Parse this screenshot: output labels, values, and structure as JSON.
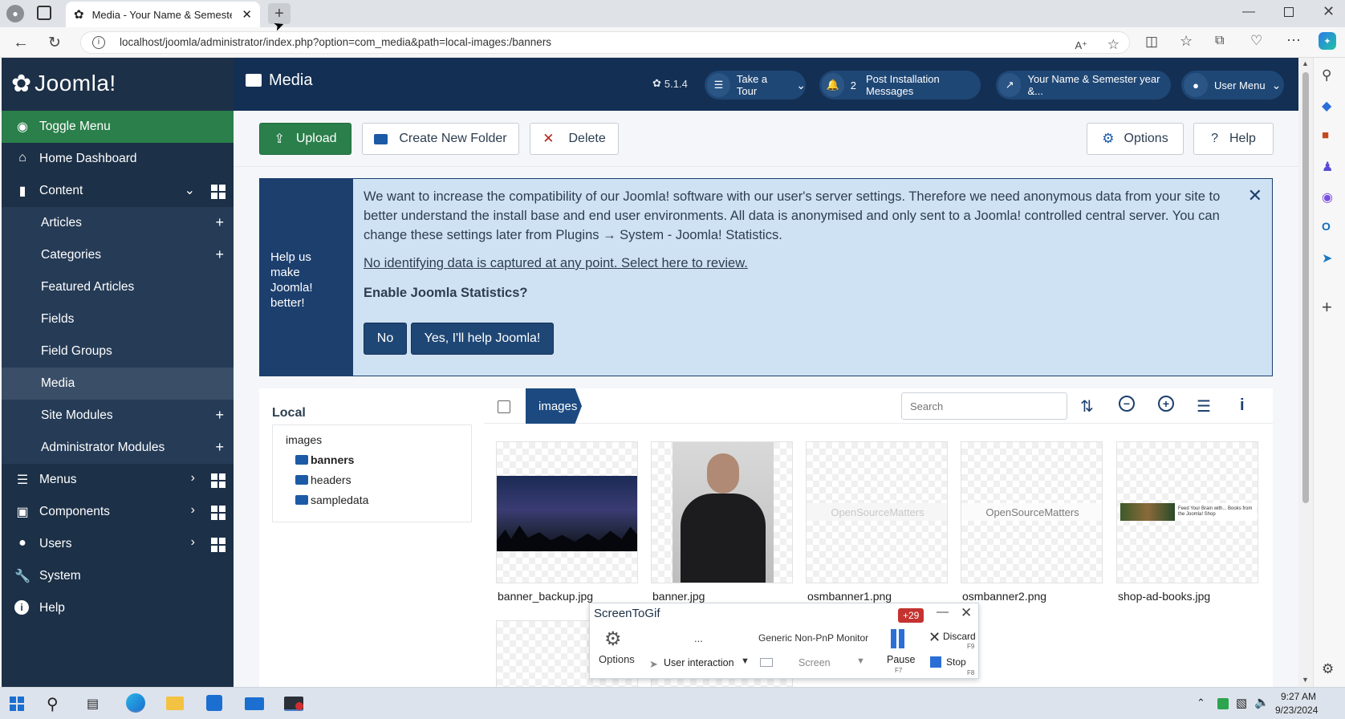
{
  "browser": {
    "tab_title": "Media - Your Name & Semester y",
    "url": "localhost/joomla/administrator/index.php?option=com_media&path=local-images:/banners"
  },
  "header": {
    "logo_text": "Joomla!",
    "page_title": "Media",
    "version": "5.1.4",
    "take_tour": "Take a Tour",
    "notif_count": "2",
    "post_install": "Post Installation Messages",
    "site_link": "Your Name & Semester year &...",
    "user_menu": "User Menu"
  },
  "sidebar": {
    "toggle": "Toggle Menu",
    "home": "Home Dashboard",
    "content": "Content",
    "articles": "Articles",
    "categories": "Categories",
    "featured": "Featured Articles",
    "fields": "Fields",
    "field_groups": "Field Groups",
    "media": "Media",
    "site_modules": "Site Modules",
    "admin_modules": "Administrator Modules",
    "menus": "Menus",
    "components": "Components",
    "users": "Users",
    "system": "System",
    "help": "Help"
  },
  "toolbar": {
    "upload": "Upload",
    "new_folder": "Create New Folder",
    "delete": "Delete",
    "options": "Options",
    "help": "Help"
  },
  "stats": {
    "side_text": "Help us make Joomla! better!",
    "para": "We want to increase the compatibility of our Joomla! software with our user's server settings. Therefore we need anonymous data from your site to better understand the install base and end user environments. All data is anonymised and only sent to a Joomla! controlled central server. You can change these settings later from Plugins → System - Joomla! Statistics.",
    "link": "No identifying data is captured at any point. Select here to review.",
    "question": "Enable Joomla Statistics?",
    "no": "No",
    "yes": "Yes, I'll help Joomla!"
  },
  "media": {
    "local": "Local",
    "tree_root": "images",
    "folders": [
      "banners",
      "headers",
      "sampledata"
    ],
    "breadcrumb": "images",
    "search_placeholder": "Search",
    "files": [
      "banner_backup.jpg",
      "banner.jpg",
      "osmbanner1.png",
      "osmbanner2.png",
      "shop-ad-books.jpg"
    ],
    "osm_text": "OpenSourceMatters",
    "shop_text": "Feed Your Brain with... Books from the Joomla! Shop"
  },
  "screentogif": {
    "title": "ScreenToGif",
    "badge": "+29",
    "options": "Options",
    "dots": "...",
    "user_interaction": "User interaction",
    "monitor": "Generic Non-PnP Monitor",
    "screen": "Screen",
    "pause": "Pause",
    "pause_key": "F7",
    "discard": "Discard",
    "discard_key": "F9",
    "stop": "Stop",
    "stop_key": "F8"
  },
  "taskbar": {
    "time": "9:27 AM",
    "date": "9/23/2024"
  },
  "colors": {
    "sidebar_bg": "#1c3047",
    "header_bg": "#132f53",
    "accent_green": "#2a7f4a",
    "stats_bg": "#cfe2f3",
    "stats_accent": "#1c3f6e"
  }
}
